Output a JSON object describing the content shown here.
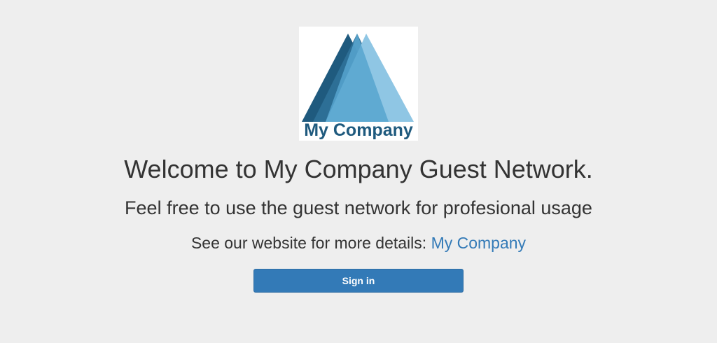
{
  "logo": {
    "icon": "triangle-mountains-logo",
    "text": "My Company",
    "colors": [
      "#1f5a7e",
      "#2f7199",
      "#57a5cf",
      "#8fc6e4"
    ]
  },
  "headline": "Welcome to My Company Guest Network.",
  "subheadline": "Feel free to use the guest network for profesional usage",
  "details": {
    "prefix": "See our website for more details: ",
    "link_text": "My Company"
  },
  "signin_button": {
    "label": "Sign in",
    "color": "#337ab7"
  },
  "background_color": "#eeeeee"
}
